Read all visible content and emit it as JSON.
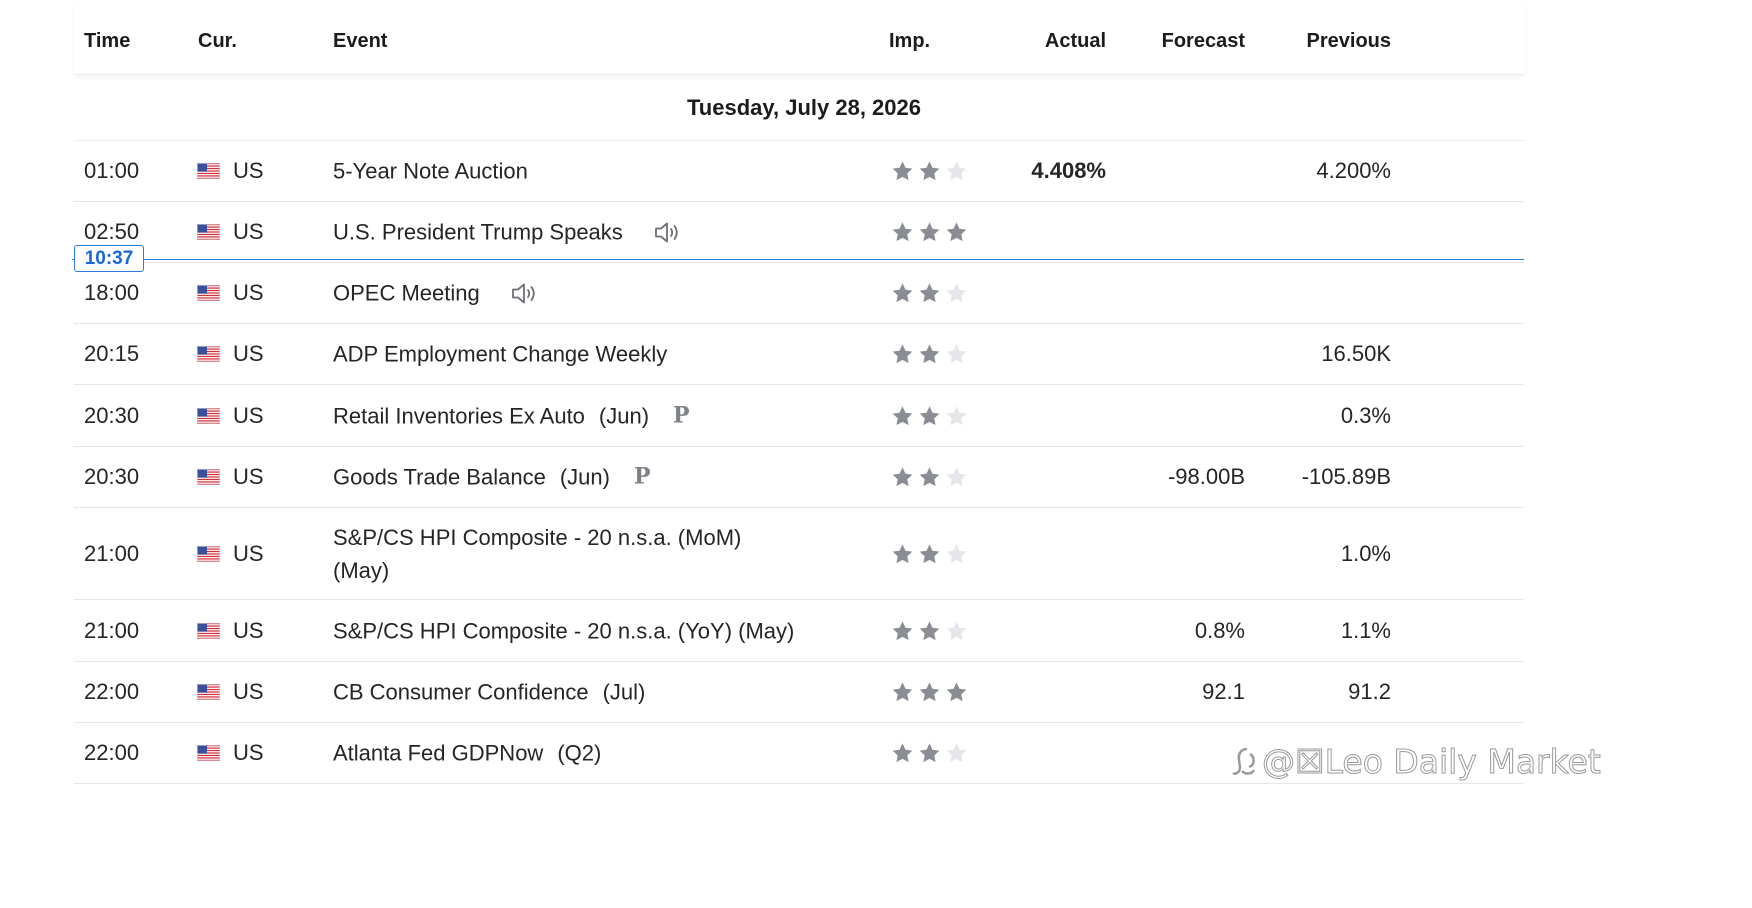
{
  "header": {
    "time": "Time",
    "currency": "Cur.",
    "event": "Event",
    "importance": "Imp.",
    "actual": "Actual",
    "forecast": "Forecast",
    "previous": "Previous"
  },
  "day_label": "Tuesday, July 28, 2026",
  "current_time": "10:37",
  "watermark": "@☒Leo Daily Market",
  "colors": {
    "star_active": "#8a8d93",
    "star_inactive": "#e4e6e9",
    "current_time_accent": "#2f7be0"
  },
  "events": [
    {
      "time": "01:00",
      "currency": "US",
      "event": "5-Year Note Auction",
      "period": "",
      "importance": 2,
      "actual": "4.408%",
      "forecast": "",
      "previous": "4.200%",
      "has_audio": false,
      "preliminary": false
    },
    {
      "time": "02:50",
      "currency": "US",
      "event": "U.S. President Trump Speaks",
      "period": "",
      "importance": 3,
      "actual": "",
      "forecast": "",
      "previous": "",
      "has_audio": true,
      "preliminary": false
    },
    {
      "time": "18:00",
      "currency": "US",
      "event": "OPEC Meeting",
      "period": "",
      "importance": 2,
      "actual": "",
      "forecast": "",
      "previous": "",
      "has_audio": true,
      "preliminary": false
    },
    {
      "time": "20:15",
      "currency": "US",
      "event": "ADP Employment Change Weekly",
      "period": "",
      "importance": 2,
      "actual": "",
      "forecast": "",
      "previous": "16.50K",
      "has_audio": false,
      "preliminary": false
    },
    {
      "time": "20:30",
      "currency": "US",
      "event": "Retail Inventories Ex Auto",
      "period": "(Jun)",
      "importance": 2,
      "actual": "",
      "forecast": "",
      "previous": "0.3%",
      "has_audio": false,
      "preliminary": true
    },
    {
      "time": "20:30",
      "currency": "US",
      "event": "Goods Trade Balance",
      "period": "(Jun)",
      "importance": 2,
      "actual": "",
      "forecast": "-98.00B",
      "previous": "-105.89B",
      "has_audio": false,
      "preliminary": true
    },
    {
      "time": "21:00",
      "currency": "US",
      "event": "S&P/CS HPI Composite - 20 n.s.a. (MoM) (May)",
      "period": "",
      "importance": 2,
      "actual": "",
      "forecast": "",
      "previous": "1.0%",
      "has_audio": false,
      "preliminary": false
    },
    {
      "time": "21:00",
      "currency": "US",
      "event": "S&P/CS HPI Composite - 20 n.s.a. (YoY) (May)",
      "period": "",
      "importance": 2,
      "actual": "",
      "forecast": "0.8%",
      "previous": "1.1%",
      "has_audio": false,
      "preliminary": false
    },
    {
      "time": "22:00",
      "currency": "US",
      "event": "CB Consumer Confidence",
      "period": "(Jul)",
      "importance": 3,
      "actual": "",
      "forecast": "92.1",
      "previous": "91.2",
      "has_audio": false,
      "preliminary": false
    },
    {
      "time": "22:00",
      "currency": "US",
      "event": "Atlanta Fed GDPNow",
      "period": "(Q2)",
      "importance": 2,
      "actual": "",
      "forecast": "",
      "previous": "",
      "has_audio": false,
      "preliminary": false
    }
  ],
  "preliminary_marker": "P"
}
